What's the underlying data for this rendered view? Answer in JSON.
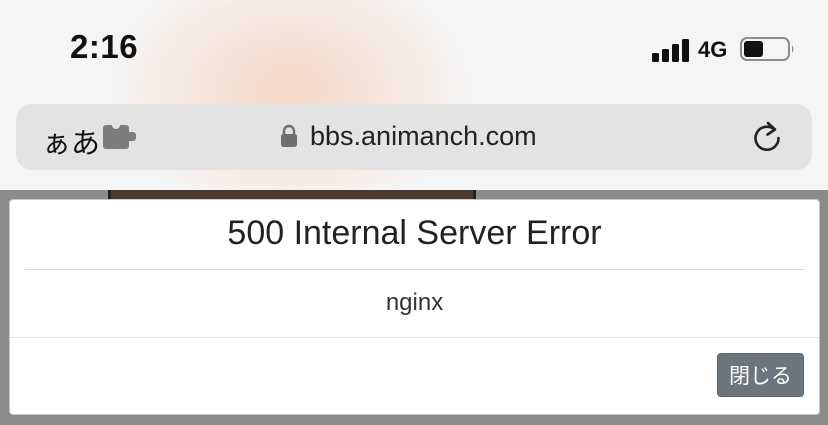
{
  "status_bar": {
    "time": "2:16",
    "network": "4G",
    "signal_icon": "cellular-signal-icon",
    "battery_icon": "battery-icon",
    "battery_level": 0.45
  },
  "browser": {
    "text_size_label": "ぁあ",
    "extension_icon": "puzzle-piece-icon",
    "lock_icon": "lock-icon",
    "url": "bbs.animanch.com",
    "reload_icon": "reload-icon"
  },
  "dialog": {
    "title": "500 Internal Server Error",
    "body": "nginx",
    "close_label": "閉じる",
    "close_button_color": "#6c757d"
  }
}
